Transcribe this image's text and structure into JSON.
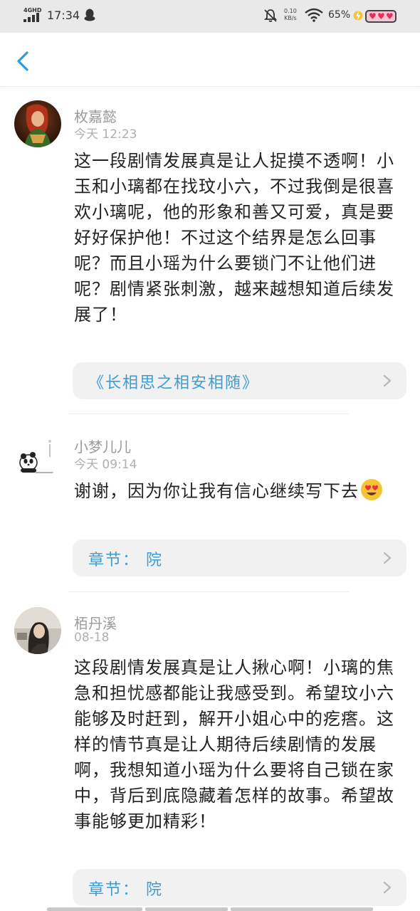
{
  "status_bar": {
    "network": "4GHD",
    "time": "17:34",
    "speed_value": "0.10",
    "speed_unit": "KB/s",
    "battery": "65%"
  },
  "header": {
    "back_icon": "chevron-left-icon",
    "accent_color": "#2e9be0"
  },
  "comments": [
    {
      "username": "枚嘉懿",
      "time": "今天 12:23",
      "text": "这一段剧情发展真是让人捉摸不透啊！小玉和小璃都在找玟小六，不过我倒是很喜欢小璃呢，他的形象和善又可爱，真是要好好保护他！不过这个结界是怎么回事呢？而且小瑶为什么要锁门不让他们进呢？剧情紧张刺激，越来越想知道后续发展了！",
      "link_label": "《长相思之相安相随》"
    },
    {
      "username": "小梦儿儿",
      "time": "今天 09:14",
      "text": "谢谢，因为你让我有信心继续写下去",
      "emoji": "heart-eyes-emoji",
      "link_label": "章节：  院"
    },
    {
      "username": "栢丹溪",
      "time": "08-18",
      "text": "这段剧情发展真是让人揪心啊！小璃的焦急和担忧感都能让我感受到。希望玟小六能够及时赶到，解开小姐心中的疙瘩。这样的情节真是让人期待后续剧情的发展啊，我想知道小瑶为什么要将自己锁在家中，背后到底隐藏着怎样的故事。希望故事能够更加精彩！",
      "link_label": "章节：  院"
    }
  ],
  "colors": {
    "link_text": "#3c9dd6",
    "card_background": "#f1f1f1",
    "meta_text": "#9a9a9a"
  }
}
